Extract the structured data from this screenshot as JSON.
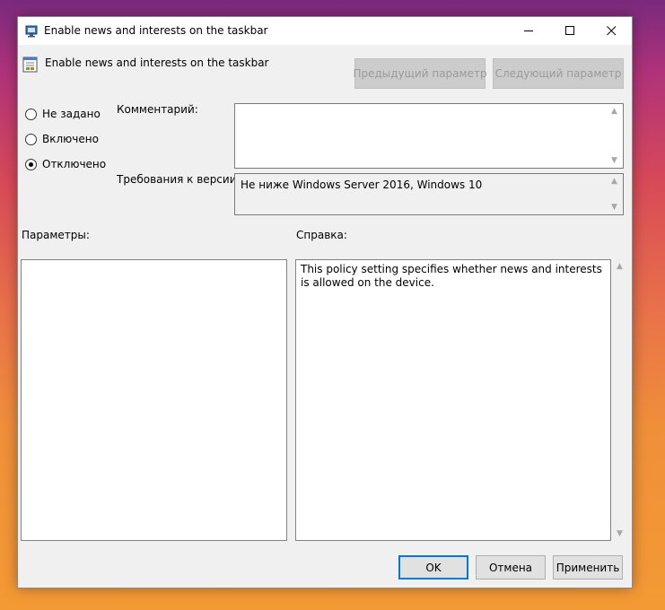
{
  "window": {
    "title": "Enable news and interests on the taskbar",
    "policy_name": "Enable news and interests on the taskbar"
  },
  "nav": {
    "prev_label": "Предыдущий параметр",
    "next_label": "Следующий параметр"
  },
  "state": {
    "options": [
      {
        "label": "Не задано",
        "checked": false
      },
      {
        "label": "Включено",
        "checked": false
      },
      {
        "label": "Отключено",
        "checked": true
      }
    ]
  },
  "comment": {
    "label": "Комментарий:",
    "value": ""
  },
  "requirements": {
    "label": "Требования к версии:",
    "value": "Не ниже Windows Server 2016, Windows 10"
  },
  "options_panel": {
    "label": "Параметры:"
  },
  "help_panel": {
    "label": "Справка:",
    "text": "This policy setting specifies whether news and interests is allowed on the device."
  },
  "footer": {
    "ok_label": "OK",
    "cancel_label": "Отмена",
    "apply_label": "Применить"
  },
  "icons": {
    "title_icon": "policy-settings-icon",
    "policy_icon": "policy-setting-icon",
    "minimize": "minimize-icon",
    "maximize": "maximize-icon",
    "close": "close-icon",
    "scroll_up": "chevron-up-icon",
    "scroll_down": "chevron-down-icon"
  },
  "colors": {
    "accent": "#0078d7",
    "window_bg": "#f0f0f0",
    "disabled_text": "#9a9a9a"
  }
}
